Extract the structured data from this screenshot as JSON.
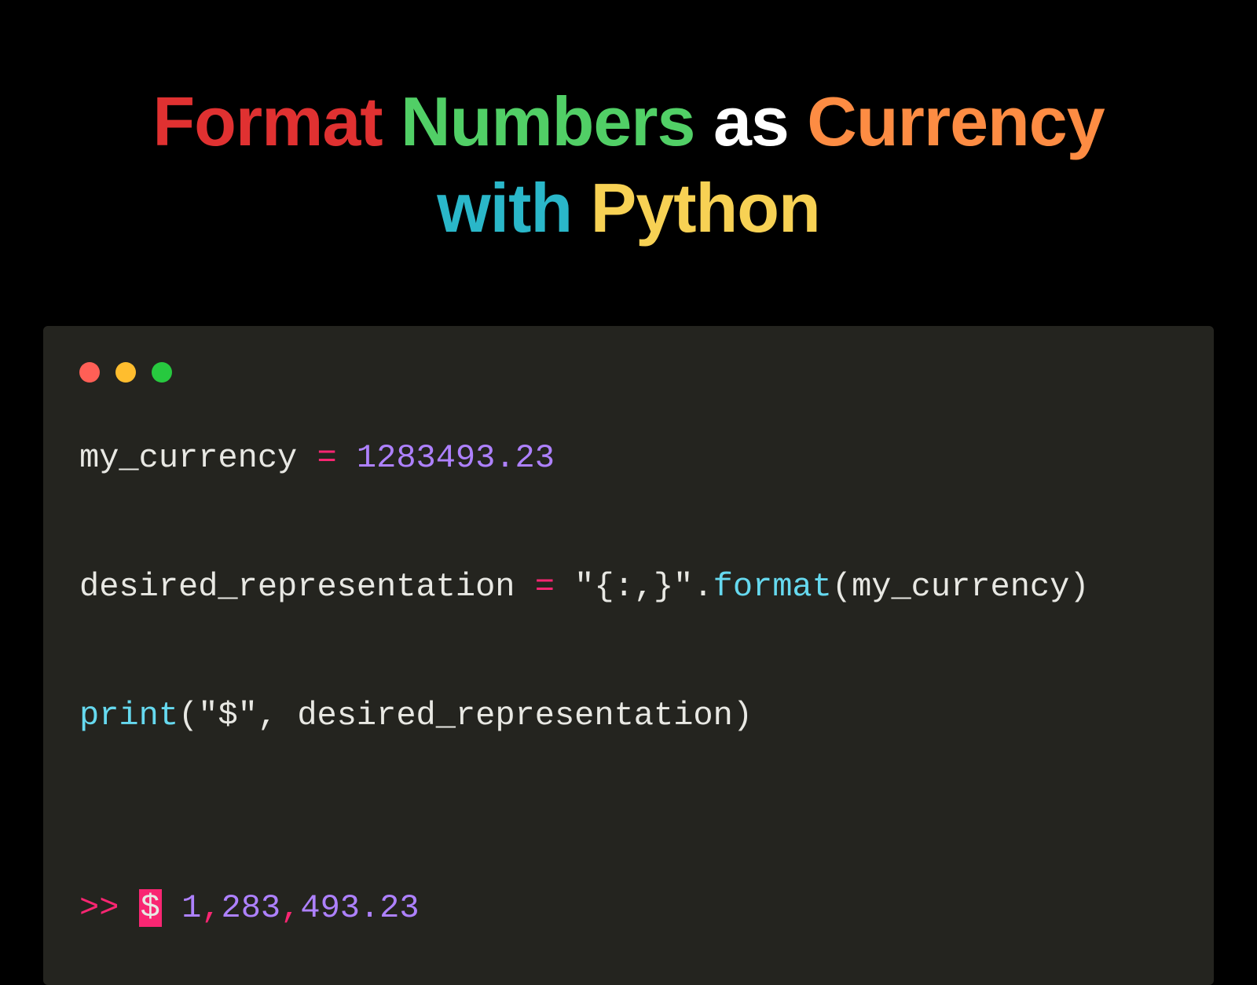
{
  "heading": {
    "w1": "Format",
    "w2": "Numbers",
    "w3": "as",
    "w4": "Currency",
    "w5": "with",
    "w6": "Python"
  },
  "code": {
    "line1": {
      "var": "my_currency",
      "op": "=",
      "num": "1283493.23"
    },
    "line2": {
      "var": "desired_representation",
      "op": "=",
      "str": "\"{:,}\"",
      "dot": ".",
      "method": "format",
      "arg": "my_currency"
    },
    "line3": {
      "func": "print",
      "str": "\"$\"",
      "comma": ",",
      "arg": "desired_representation"
    },
    "output": {
      "prompt": ">>",
      "dollar": "$",
      "p1": "1",
      "c1": ",",
      "p2": "283",
      "c2": ",",
      "p3": "493.23"
    }
  }
}
